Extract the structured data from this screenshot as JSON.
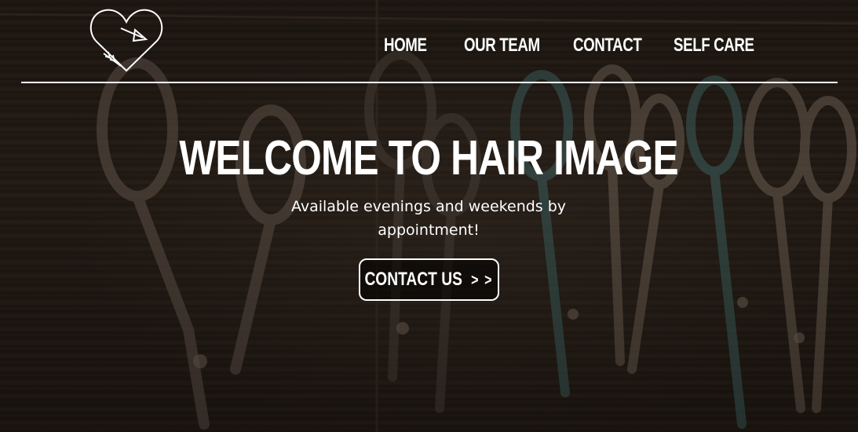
{
  "nav": {
    "items": [
      {
        "label": "HOME"
      },
      {
        "label": "OUR TEAM"
      },
      {
        "label": "CONTACT"
      },
      {
        "label": "SELF CARE"
      }
    ]
  },
  "hero": {
    "title": "WELCOME TO HAIR IMAGE",
    "subtitle": "Available evenings and weekends by appointment!",
    "cta_label": "CONTACT US",
    "cta_arrows": "> >"
  },
  "logo": {
    "icon": "heart-arrow-icon"
  },
  "background": {
    "icon": "hanging-scissors-photo"
  },
  "colors": {
    "text": "#ffffff",
    "background": "#241b15"
  }
}
